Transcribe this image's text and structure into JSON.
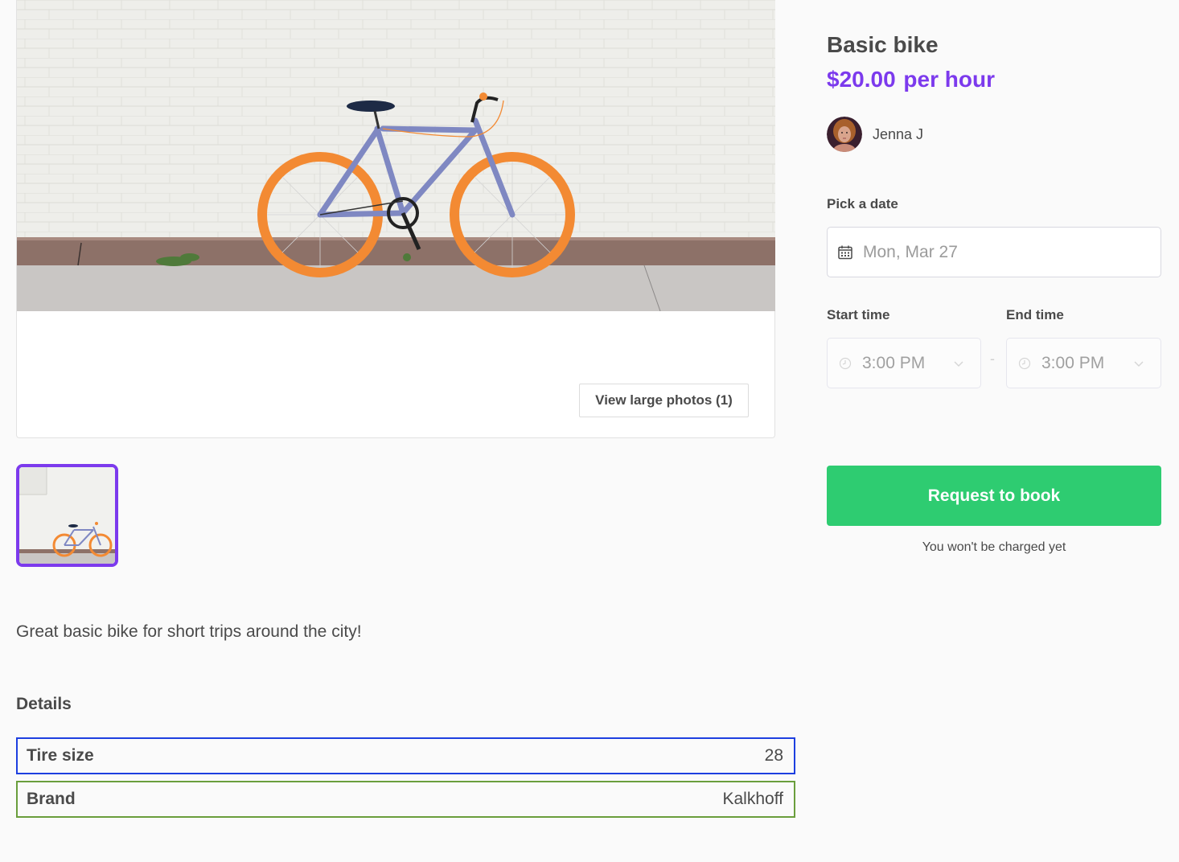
{
  "listing": {
    "title": "Basic bike",
    "price": "$20.00",
    "price_unit": "per hour",
    "description": "Great basic bike for short trips around the city!"
  },
  "author": {
    "name": "Jenna J",
    "avatar_icon": "user-avatar-photo"
  },
  "gallery": {
    "hero_image_alt": "Blue bike with orange wheels leaning on a white brick wall",
    "view_photos_label": "View large photos (1)",
    "thumbnails": [
      {
        "alt": "Bike photo thumbnail",
        "selected": true
      }
    ]
  },
  "booking": {
    "date_label": "Pick a date",
    "date_value": "Mon, Mar 27",
    "date_icon": "calendar-icon",
    "start_label": "Start time",
    "end_label": "End time",
    "start_value": "3:00 PM",
    "end_value": "3:00 PM",
    "time_separator": "-",
    "time_icon": "clock-icon",
    "submit_label": "Request to book",
    "charge_note": "You won't be charged yet"
  },
  "details": {
    "heading": "Details",
    "rows": [
      {
        "label": "Tire size",
        "value": "28"
      },
      {
        "label": "Brand",
        "value": "Kalkhoff"
      }
    ]
  },
  "colors": {
    "accent": "#7c3aed",
    "submit": "#2ecc71",
    "tire_row_border": "#1d3fe0",
    "brand_row_border": "#6a9e3c"
  }
}
